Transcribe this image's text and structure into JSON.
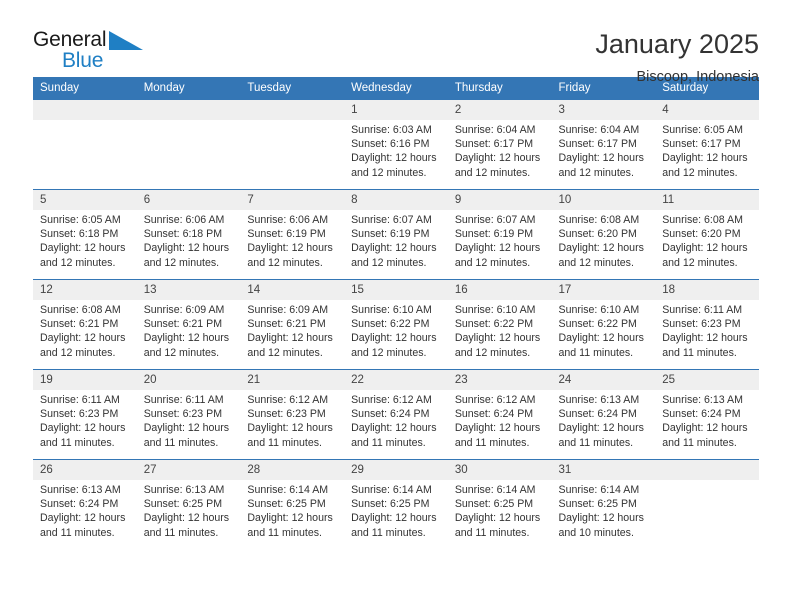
{
  "brand": {
    "name_part1": "General",
    "name_part2": "Blue",
    "flag_color": "#1f7fc4",
    "text_color": "#1a1a1a"
  },
  "header": {
    "title": "January 2025",
    "subtitle": "Biscoop, Indonesia"
  },
  "theme": {
    "header_bg": "#3476b5",
    "header_text": "#ffffff",
    "daynum_bg": "#efefef",
    "grid_line": "#3476b5",
    "body_text": "#333333"
  },
  "weekday_headers": [
    "Sunday",
    "Monday",
    "Tuesday",
    "Wednesday",
    "Thursday",
    "Friday",
    "Saturday"
  ],
  "weeks": [
    [
      {
        "day": "",
        "sunrise": "",
        "sunset": "",
        "daylight_line1": "",
        "daylight_line2": "",
        "shaded": true,
        "empty": true
      },
      {
        "day": "",
        "sunrise": "",
        "sunset": "",
        "daylight_line1": "",
        "daylight_line2": "",
        "shaded": true,
        "empty": true
      },
      {
        "day": "",
        "sunrise": "",
        "sunset": "",
        "daylight_line1": "",
        "daylight_line2": "",
        "shaded": true,
        "empty": true
      },
      {
        "day": "1",
        "sunrise": "Sunrise: 6:03 AM",
        "sunset": "Sunset: 6:16 PM",
        "daylight_line1": "Daylight: 12 hours",
        "daylight_line2": "and 12 minutes.",
        "shaded": true,
        "empty": false
      },
      {
        "day": "2",
        "sunrise": "Sunrise: 6:04 AM",
        "sunset": "Sunset: 6:17 PM",
        "daylight_line1": "Daylight: 12 hours",
        "daylight_line2": "and 12 minutes.",
        "shaded": true,
        "empty": false
      },
      {
        "day": "3",
        "sunrise": "Sunrise: 6:04 AM",
        "sunset": "Sunset: 6:17 PM",
        "daylight_line1": "Daylight: 12 hours",
        "daylight_line2": "and 12 minutes.",
        "shaded": true,
        "empty": false
      },
      {
        "day": "4",
        "sunrise": "Sunrise: 6:05 AM",
        "sunset": "Sunset: 6:17 PM",
        "daylight_line1": "Daylight: 12 hours",
        "daylight_line2": "and 12 minutes.",
        "shaded": true,
        "empty": false
      }
    ],
    [
      {
        "day": "5",
        "sunrise": "Sunrise: 6:05 AM",
        "sunset": "Sunset: 6:18 PM",
        "daylight_line1": "Daylight: 12 hours",
        "daylight_line2": "and 12 minutes.",
        "shaded": true,
        "empty": false
      },
      {
        "day": "6",
        "sunrise": "Sunrise: 6:06 AM",
        "sunset": "Sunset: 6:18 PM",
        "daylight_line1": "Daylight: 12 hours",
        "daylight_line2": "and 12 minutes.",
        "shaded": true,
        "empty": false
      },
      {
        "day": "7",
        "sunrise": "Sunrise: 6:06 AM",
        "sunset": "Sunset: 6:19 PM",
        "daylight_line1": "Daylight: 12 hours",
        "daylight_line2": "and 12 minutes.",
        "shaded": true,
        "empty": false
      },
      {
        "day": "8",
        "sunrise": "Sunrise: 6:07 AM",
        "sunset": "Sunset: 6:19 PM",
        "daylight_line1": "Daylight: 12 hours",
        "daylight_line2": "and 12 minutes.",
        "shaded": true,
        "empty": false
      },
      {
        "day": "9",
        "sunrise": "Sunrise: 6:07 AM",
        "sunset": "Sunset: 6:19 PM",
        "daylight_line1": "Daylight: 12 hours",
        "daylight_line2": "and 12 minutes.",
        "shaded": true,
        "empty": false
      },
      {
        "day": "10",
        "sunrise": "Sunrise: 6:08 AM",
        "sunset": "Sunset: 6:20 PM",
        "daylight_line1": "Daylight: 12 hours",
        "daylight_line2": "and 12 minutes.",
        "shaded": true,
        "empty": false
      },
      {
        "day": "11",
        "sunrise": "Sunrise: 6:08 AM",
        "sunset": "Sunset: 6:20 PM",
        "daylight_line1": "Daylight: 12 hours",
        "daylight_line2": "and 12 minutes.",
        "shaded": true,
        "empty": false
      }
    ],
    [
      {
        "day": "12",
        "sunrise": "Sunrise: 6:08 AM",
        "sunset": "Sunset: 6:21 PM",
        "daylight_line1": "Daylight: 12 hours",
        "daylight_line2": "and 12 minutes.",
        "shaded": true,
        "empty": false
      },
      {
        "day": "13",
        "sunrise": "Sunrise: 6:09 AM",
        "sunset": "Sunset: 6:21 PM",
        "daylight_line1": "Daylight: 12 hours",
        "daylight_line2": "and 12 minutes.",
        "shaded": true,
        "empty": false
      },
      {
        "day": "14",
        "sunrise": "Sunrise: 6:09 AM",
        "sunset": "Sunset: 6:21 PM",
        "daylight_line1": "Daylight: 12 hours",
        "daylight_line2": "and 12 minutes.",
        "shaded": true,
        "empty": false
      },
      {
        "day": "15",
        "sunrise": "Sunrise: 6:10 AM",
        "sunset": "Sunset: 6:22 PM",
        "daylight_line1": "Daylight: 12 hours",
        "daylight_line2": "and 12 minutes.",
        "shaded": true,
        "empty": false
      },
      {
        "day": "16",
        "sunrise": "Sunrise: 6:10 AM",
        "sunset": "Sunset: 6:22 PM",
        "daylight_line1": "Daylight: 12 hours",
        "daylight_line2": "and 12 minutes.",
        "shaded": true,
        "empty": false
      },
      {
        "day": "17",
        "sunrise": "Sunrise: 6:10 AM",
        "sunset": "Sunset: 6:22 PM",
        "daylight_line1": "Daylight: 12 hours",
        "daylight_line2": "and 11 minutes.",
        "shaded": true,
        "empty": false
      },
      {
        "day": "18",
        "sunrise": "Sunrise: 6:11 AM",
        "sunset": "Sunset: 6:23 PM",
        "daylight_line1": "Daylight: 12 hours",
        "daylight_line2": "and 11 minutes.",
        "shaded": true,
        "empty": false
      }
    ],
    [
      {
        "day": "19",
        "sunrise": "Sunrise: 6:11 AM",
        "sunset": "Sunset: 6:23 PM",
        "daylight_line1": "Daylight: 12 hours",
        "daylight_line2": "and 11 minutes.",
        "shaded": true,
        "empty": false
      },
      {
        "day": "20",
        "sunrise": "Sunrise: 6:11 AM",
        "sunset": "Sunset: 6:23 PM",
        "daylight_line1": "Daylight: 12 hours",
        "daylight_line2": "and 11 minutes.",
        "shaded": true,
        "empty": false
      },
      {
        "day": "21",
        "sunrise": "Sunrise: 6:12 AM",
        "sunset": "Sunset: 6:23 PM",
        "daylight_line1": "Daylight: 12 hours",
        "daylight_line2": "and 11 minutes.",
        "shaded": true,
        "empty": false
      },
      {
        "day": "22",
        "sunrise": "Sunrise: 6:12 AM",
        "sunset": "Sunset: 6:24 PM",
        "daylight_line1": "Daylight: 12 hours",
        "daylight_line2": "and 11 minutes.",
        "shaded": true,
        "empty": false
      },
      {
        "day": "23",
        "sunrise": "Sunrise: 6:12 AM",
        "sunset": "Sunset: 6:24 PM",
        "daylight_line1": "Daylight: 12 hours",
        "daylight_line2": "and 11 minutes.",
        "shaded": true,
        "empty": false
      },
      {
        "day": "24",
        "sunrise": "Sunrise: 6:13 AM",
        "sunset": "Sunset: 6:24 PM",
        "daylight_line1": "Daylight: 12 hours",
        "daylight_line2": "and 11 minutes.",
        "shaded": true,
        "empty": false
      },
      {
        "day": "25",
        "sunrise": "Sunrise: 6:13 AM",
        "sunset": "Sunset: 6:24 PM",
        "daylight_line1": "Daylight: 12 hours",
        "daylight_line2": "and 11 minutes.",
        "shaded": true,
        "empty": false
      }
    ],
    [
      {
        "day": "26",
        "sunrise": "Sunrise: 6:13 AM",
        "sunset": "Sunset: 6:24 PM",
        "daylight_line1": "Daylight: 12 hours",
        "daylight_line2": "and 11 minutes.",
        "shaded": true,
        "empty": false
      },
      {
        "day": "27",
        "sunrise": "Sunrise: 6:13 AM",
        "sunset": "Sunset: 6:25 PM",
        "daylight_line1": "Daylight: 12 hours",
        "daylight_line2": "and 11 minutes.",
        "shaded": true,
        "empty": false
      },
      {
        "day": "28",
        "sunrise": "Sunrise: 6:14 AM",
        "sunset": "Sunset: 6:25 PM",
        "daylight_line1": "Daylight: 12 hours",
        "daylight_line2": "and 11 minutes.",
        "shaded": true,
        "empty": false
      },
      {
        "day": "29",
        "sunrise": "Sunrise: 6:14 AM",
        "sunset": "Sunset: 6:25 PM",
        "daylight_line1": "Daylight: 12 hours",
        "daylight_line2": "and 11 minutes.",
        "shaded": true,
        "empty": false
      },
      {
        "day": "30",
        "sunrise": "Sunrise: 6:14 AM",
        "sunset": "Sunset: 6:25 PM",
        "daylight_line1": "Daylight: 12 hours",
        "daylight_line2": "and 11 minutes.",
        "shaded": true,
        "empty": false
      },
      {
        "day": "31",
        "sunrise": "Sunrise: 6:14 AM",
        "sunset": "Sunset: 6:25 PM",
        "daylight_line1": "Daylight: 12 hours",
        "daylight_line2": "and 10 minutes.",
        "shaded": true,
        "empty": false
      },
      {
        "day": "",
        "sunrise": "",
        "sunset": "",
        "daylight_line1": "",
        "daylight_line2": "",
        "shaded": false,
        "empty": true
      }
    ]
  ]
}
